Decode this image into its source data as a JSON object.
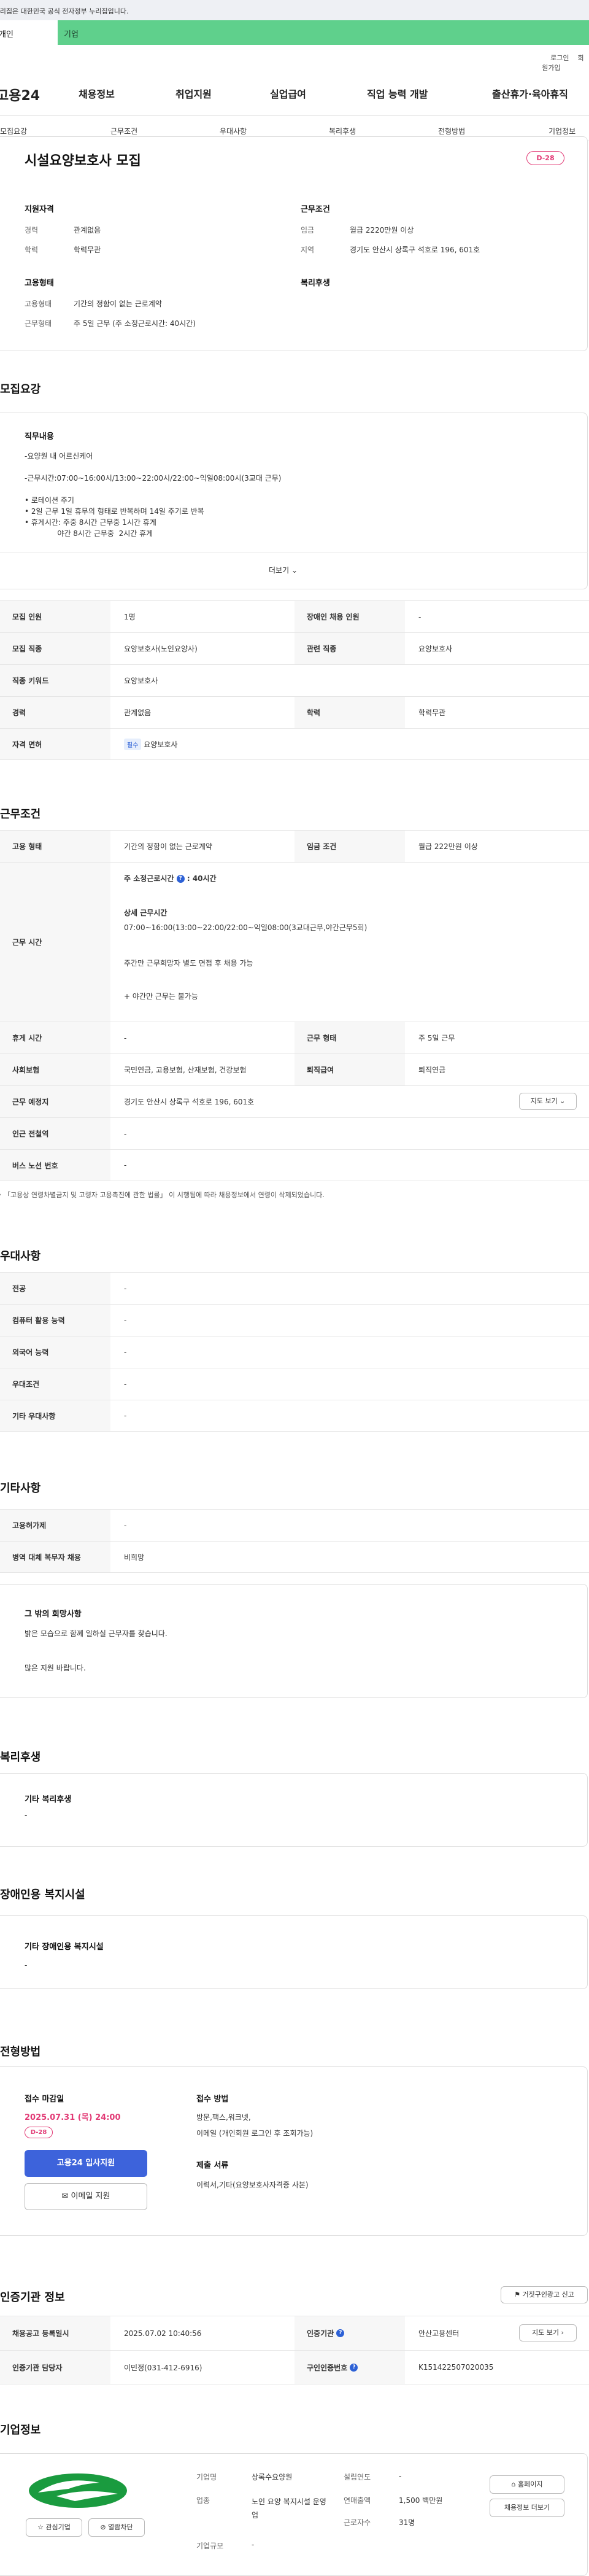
{
  "gov": {
    "text": "이 누리집은 대한민국 공식 전자정부 누리집입니다."
  },
  "gnb": {
    "tab1": "개인",
    "tab2": "기업"
  },
  "util": {
    "login": "로그인",
    "join": "회원가입"
  },
  "header": {
    "logo": "고용24",
    "menu": [
      "채용정보",
      "취업지원",
      "실업급여",
      "직업 능력 개발",
      "출산휴가·육아휴직"
    ]
  },
  "subnav": [
    "모집요강",
    "근무조건",
    "우대사항",
    "복리후생",
    "전형방법",
    "기업정보"
  ],
  "summary": {
    "title": "시설요양보호사 모집",
    "dday": "D-28",
    "qual_h": "지원자격",
    "qual": [
      [
        "경력",
        "관계없음"
      ],
      [
        "학력",
        "학력무관"
      ]
    ],
    "cond_h": "근무조건",
    "cond": [
      [
        "임금",
        "월급 2220만원 이상"
      ],
      [
        "지역",
        "경기도 안산시 상록구 석호로 196, 601호"
      ]
    ],
    "emp_h": "고용형태",
    "emp": [
      [
        "고용형태",
        "기간의 정함이 없는 근로계약"
      ],
      [
        "근무형태",
        "주 5일 근무 (주 소정근로시간: 40시간)"
      ]
    ],
    "welfare_h": "복리후생"
  },
  "recruit": {
    "title": "모집요강",
    "duty_h": "직무내용",
    "lines": [
      "-요양원 내 어르신케어",
      "-근무시간:07:00~16:00시/13:00~22:00시/22:00~익일08:00시(3교대 근무)",
      "• 로테이션 주기",
      "• 2일 근무 1일 휴무의 형태로 반복하며 14일 주기로 반복",
      "• 휴게시간: 주중 8시간 근무중  1시간 휴게",
      "              야간 8시간 근무중  2시간 휴게"
    ],
    "more": "더보기",
    "rows": [
      [
        "모집 인원",
        "1명",
        "장애인 채용 인원",
        "-"
      ],
      [
        "모집 직종",
        "요양보호사(노인요양사)",
        "관련 직종",
        "요양보호사"
      ],
      [
        "직종 키워드",
        "요양보호사",
        "",
        ""
      ],
      [
        "경력",
        "관계없음",
        "학력",
        "학력무관"
      ],
      [
        "자격 면허",
        "요양보호사",
        "",
        ""
      ]
    ],
    "license_tag": "필수"
  },
  "work": {
    "title": "근무조건",
    "r1": [
      "고용 형태",
      "기간의 정함이 없는 근로계약",
      "임금 조건",
      "월급 222만원 이상"
    ],
    "time_h": "근무 시간",
    "time_l1": "주 소정근로시간",
    "time_l1b": ": 40시간",
    "time_l2": "상세 근무시간",
    "time_l3": "07:00~16:00(13:00~22:00/22:00~익일08:00(3교대근무,야간근무5회)",
    "time_l4": "주간만 근무희망자 별도 면접 후 채용 가능",
    "time_l5": "+ 야간만 근무는 불가능",
    "r2": [
      "휴게 시간",
      "-",
      "근무 형태",
      "주 5일 근무"
    ],
    "r3": [
      "사회보험",
      "국민연금, 고용보험, 산재보험, 건강보험",
      "퇴직급여",
      "퇴직연금"
    ],
    "r4": [
      "근무 예정지",
      "경기도 안산시 상록구 석호로 196, 601호"
    ],
    "map": "지도 보기",
    "r5": [
      "인근 전철역",
      "-"
    ],
    "r6": [
      "버스 노선 번호",
      "-"
    ],
    "note": "• 「고용상 연령차별금지 및 고령자 고용촉진에 관한 법률」 이 시행됨에 따라 채용정보에서 연령이 삭제되었습니다."
  },
  "pref": {
    "title": "우대사항",
    "rows": [
      [
        "전공",
        "-"
      ],
      [
        "컴퓨터 활용 능력",
        "-"
      ],
      [
        "외국어 능력",
        "-"
      ],
      [
        "우대조건",
        "-"
      ],
      [
        "기타 우대사항",
        "-"
      ]
    ]
  },
  "etc": {
    "title": "기타사항",
    "rows": [
      [
        "고용허가제",
        "-"
      ],
      [
        "병역 대체 복무자 채용",
        "비희망"
      ]
    ],
    "wish_h": "그 밖의 희망사항",
    "wish1": "밝은 모습으로 함께 일하실 근무자를 찾습니다.",
    "wish2": "많은 지원 바랍니다."
  },
  "welfare": {
    "title": "복리후생",
    "h": "기타 복리후생",
    "v": "-"
  },
  "disabled": {
    "title": "장애인용 복지시설",
    "h": "기타 장애인용 복지시설",
    "v": "-"
  },
  "method": {
    "title": "전형방법",
    "deadline_h": "접수 마감일",
    "deadline": "2025.07.31 (목) 24:00",
    "dday": "D-28",
    "apply": "고용24 입사지원",
    "email": "이메일 지원",
    "how_h": "접수 방법",
    "how1": "방문,팩스,워크넷,",
    "how2": "이메일 (개인회원 로그인 후 조회가능)",
    "docs_h": "제출 서류",
    "docs": "이력서,기타(요양보호사자격증 사본)"
  },
  "cert": {
    "title": "인증기관 정보",
    "report": "거짓구인광고 신고",
    "r1": [
      "채용공고 등록일시",
      "2025.07.02 10:40:56",
      "인증기관",
      "안산고용센터"
    ],
    "map": "지도 보기",
    "r2": [
      "인증기관 담당자",
      "이민정(031-412-6916)",
      "구인인증번호",
      "K151422507020035"
    ]
  },
  "company": {
    "title": "기업정보",
    "fav": "관심기업",
    "block": "열람차단",
    "rows": [
      [
        "기업명",
        "상록수요양원",
        "설립연도",
        "-"
      ],
      [
        "업종",
        "노인 요양 복지시설 운영업",
        "연매출액",
        "1,500 백만원"
      ],
      [
        "기업규모",
        "-",
        "근로자수",
        "31명"
      ]
    ],
    "homepage": "홈페이지",
    "more_jobs": "채용정보 더보기"
  },
  "colors": {
    "accent": "#3d63db",
    "dday": "#e23b76",
    "gnb": "#5fd08c"
  }
}
